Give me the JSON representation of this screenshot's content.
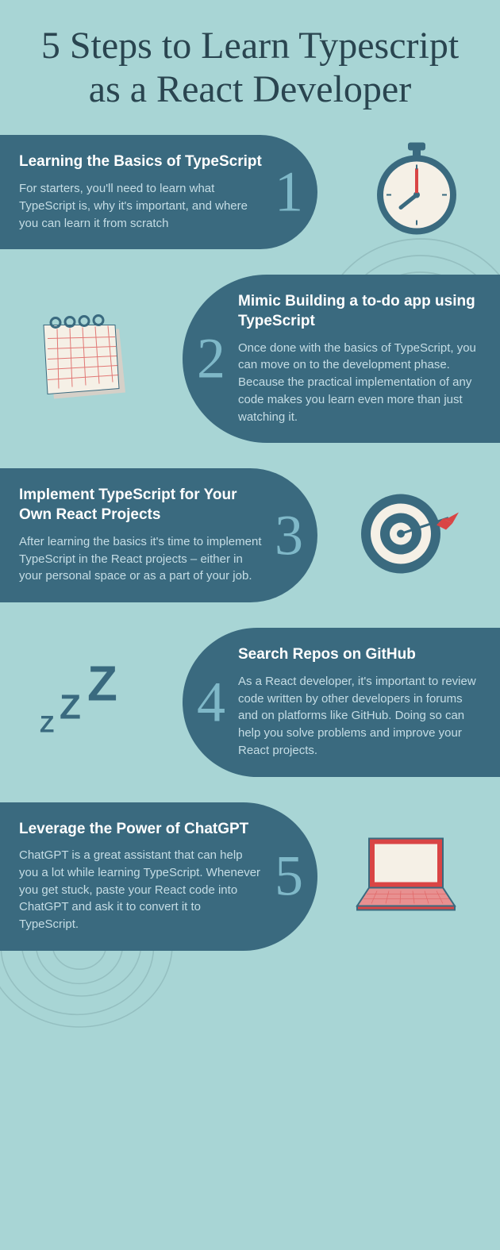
{
  "title": "5 Steps to Learn Typescript as a React Developer",
  "steps": [
    {
      "num": "1",
      "title": "Learning the Basics of TypeScript",
      "body": "For starters, you'll need to learn what TypeScript is, why it's important, and where you can learn it from scratch"
    },
    {
      "num": "2",
      "title": "Mimic Building a to-do app using TypeScript",
      "body": "Once done with the basics of TypeScript, you can move on to the development phase. Because the practical implementation of any code makes you learn even more than just watching it."
    },
    {
      "num": "3",
      "title": "Implement TypeScript for Your Own React Projects",
      "body": "After learning the basics it's time to implement TypeScript in the React projects – either in your personal space or as a part of your job."
    },
    {
      "num": "4",
      "title": "Search Repos on GitHub",
      "body": "As a React developer, it's important to review code written by other developers in forums and on platforms like GitHub. Doing so can help you solve problems and improve your React projects."
    },
    {
      "num": "5",
      "title": "Leverage the Power of ChatGPT",
      "body": "ChatGPT is a great assistant that can help you a lot while learning TypeScript. Whenever you get stuck, paste your React code into ChatGPT and ask it to convert it to TypeScript."
    }
  ]
}
